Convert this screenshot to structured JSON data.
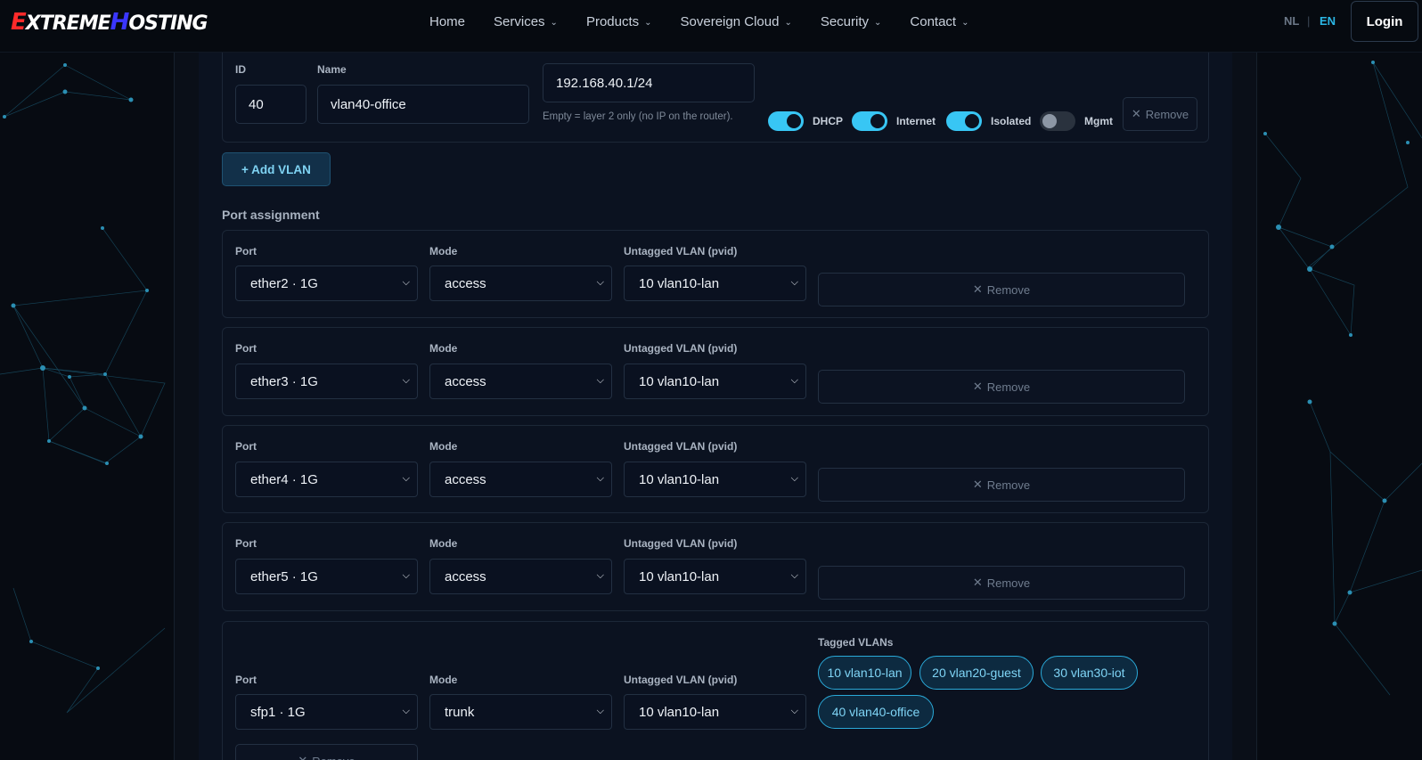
{
  "brand": {
    "logo_text_1": "E",
    "logo_text_2": "XTREME",
    "logo_text_3": "H",
    "logo_text_4": "OSTING"
  },
  "nav": {
    "items": [
      {
        "label": "Home",
        "has_menu": false
      },
      {
        "label": "Services",
        "has_menu": true
      },
      {
        "label": "Products",
        "has_menu": true
      },
      {
        "label": "Sovereign Cloud",
        "has_menu": true
      },
      {
        "label": "Security",
        "has_menu": true
      },
      {
        "label": "Contact",
        "has_menu": true
      }
    ],
    "lang_nl": "NL",
    "lang_sep": "|",
    "lang_en": "EN",
    "login": "Login"
  },
  "vlan": {
    "id_label": "ID",
    "name_label": "Name",
    "id_value": "40",
    "name_value": "vlan40-office",
    "subnet_value": "192.168.40.1/24",
    "subnet_help": "Empty = layer 2 only (no IP on the router).",
    "toggles": [
      {
        "label": "DHCP",
        "on": true
      },
      {
        "label": "Internet",
        "on": true
      },
      {
        "label": "Isolated",
        "on": true
      },
      {
        "label": "Mgmt",
        "on": false
      }
    ],
    "remove_label": "Remove"
  },
  "add_vlan_label": "+ Add VLAN",
  "port_section_title": "Port assignment",
  "port_labels": {
    "port": "Port",
    "mode": "Mode",
    "untagged": "Untagged VLAN (pvid)",
    "tagged": "Tagged VLANs",
    "remove": "Remove"
  },
  "ports": [
    {
      "port": "ether2 · 1G",
      "mode": "access",
      "pvid": "10 vlan10-lan"
    },
    {
      "port": "ether3 · 1G",
      "mode": "access",
      "pvid": "10 vlan10-lan"
    },
    {
      "port": "ether4 · 1G",
      "mode": "access",
      "pvid": "10 vlan10-lan"
    },
    {
      "port": "ether5 · 1G",
      "mode": "access",
      "pvid": "10 vlan10-lan"
    },
    {
      "port": "sfp1 · 1G",
      "mode": "trunk",
      "pvid": "10 vlan10-lan",
      "tagged": [
        "10 vlan10-lan",
        "20 vlan20-guest",
        "30 vlan30-iot",
        "40 vlan40-office"
      ]
    }
  ],
  "colors": {
    "accent": "#38c6f4",
    "background": "#070b12",
    "panel": "#0b1220",
    "brand_red": "#ff2a2a",
    "brand_blue": "#3a36ff"
  }
}
